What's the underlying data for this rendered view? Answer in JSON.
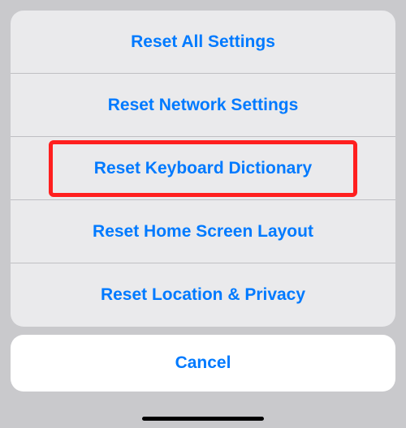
{
  "sheet": {
    "options": [
      {
        "label": "Reset All Settings"
      },
      {
        "label": "Reset Network Settings"
      },
      {
        "label": "Reset Keyboard Dictionary",
        "highlighted": true
      },
      {
        "label": "Reset Home Screen Layout"
      },
      {
        "label": "Reset Location & Privacy"
      }
    ],
    "cancel_label": "Cancel"
  },
  "colors": {
    "accent": "#007aff",
    "highlight": "#ff1f1f",
    "background": "#c9c9cc",
    "sheet_bg": "#eaeaec",
    "cancel_bg": "#ffffff"
  }
}
